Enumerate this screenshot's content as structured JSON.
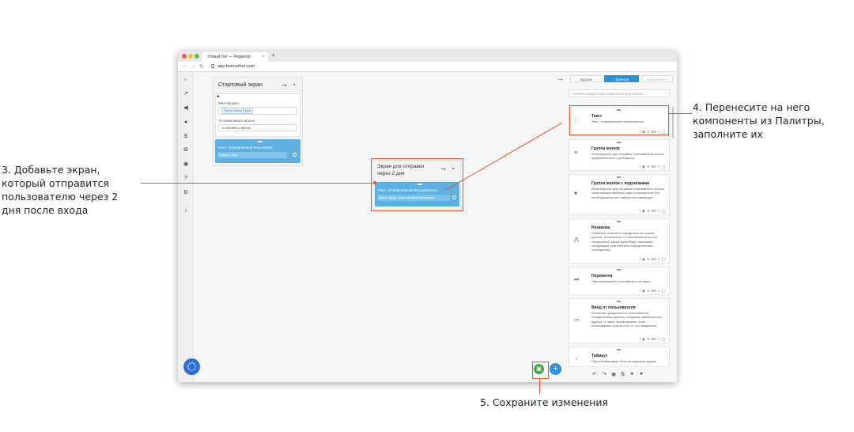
{
  "annotations": {
    "step3": "3. Добавьте экран, который отправится пользователю через 2 дня после входа",
    "step4": "4. Перенесите на него компоненты из Палитры, заполните их",
    "step5": "5. Сохраните изменения"
  },
  "browser": {
    "tab_title": "Новый бот — Редактор",
    "new_tab": "+",
    "url": "app.botmother.com"
  },
  "leftbar": {
    "icons": [
      "back-arrow-icon",
      "chart-icon",
      "megaphone-icon",
      "chat-icon",
      "dollar-icon",
      "sitemap-icon",
      "users-icon",
      "help-icon",
      "settings-icon",
      "info-icon"
    ]
  },
  "start_screen": {
    "title": "Стартовый экран",
    "label_name": "Имя ярлыка",
    "label_chip": "Только через 2 дня",
    "set_label": "Устанавливать ярлык:",
    "set_label_value": "Установить ярлык",
    "text_component_title": "Текст, отправленный пользовате",
    "text_component_input": "Привет, мир!"
  },
  "screen2": {
    "title": "Экран для отправки через 2 дня",
    "text_component_title": "Текст, отправленный пользователю",
    "text_component_input": "Здесь будет текст, который отправите"
  },
  "palette": {
    "tabs": [
      "Экраны",
      "Палитра",
      "Компоненты"
    ],
    "active_tab": "Палитра",
    "search_placeholder": "Начните вводить имя компонента для поиска...",
    "social": "f ◉ ✆ ВК ◊ ◯",
    "components": [
      {
        "title": "Текст",
        "desc": "Текст, отправленный пользователю"
      },
      {
        "title": "Группа кнопок",
        "desc": "Используется для отправки пользователю кнопок, прикрепленных к сообщению"
      },
      {
        "title": "Группа кнопок с подсказками",
        "desc": "Используется для отправки пользователю кнопок, позволяющих выбрать один из вариантов, без необходимости его набора на клавиатуре"
      },
      {
        "title": "Развилка",
        "desc": "Развилка позволяет определить на основе данных, полученных от пользователя или из переменной, какой экран будет выполнен следующим, или ответить определенным сообщением"
      },
      {
        "title": "Перемотка",
        "desc": "Перенаправляет пользователя на экран"
      },
      {
        "title": "Ввод от пользователя",
        "desc": "Позволяет дождаться от пользователя определенных данных, например фамилии или адреса, а также отреагировать, если пользователь прислал не то, что ожидалось"
      },
      {
        "title": "Таймаут",
        "desc": "Приостанавливает бота на заданное время"
      }
    ]
  },
  "colors": {
    "accent_orange": "#e8552b",
    "component_blue": "#5fb0e0",
    "save_green": "#45a84a",
    "add_blue": "#2d91d6",
    "chat_blue": "#2d6fd6"
  }
}
